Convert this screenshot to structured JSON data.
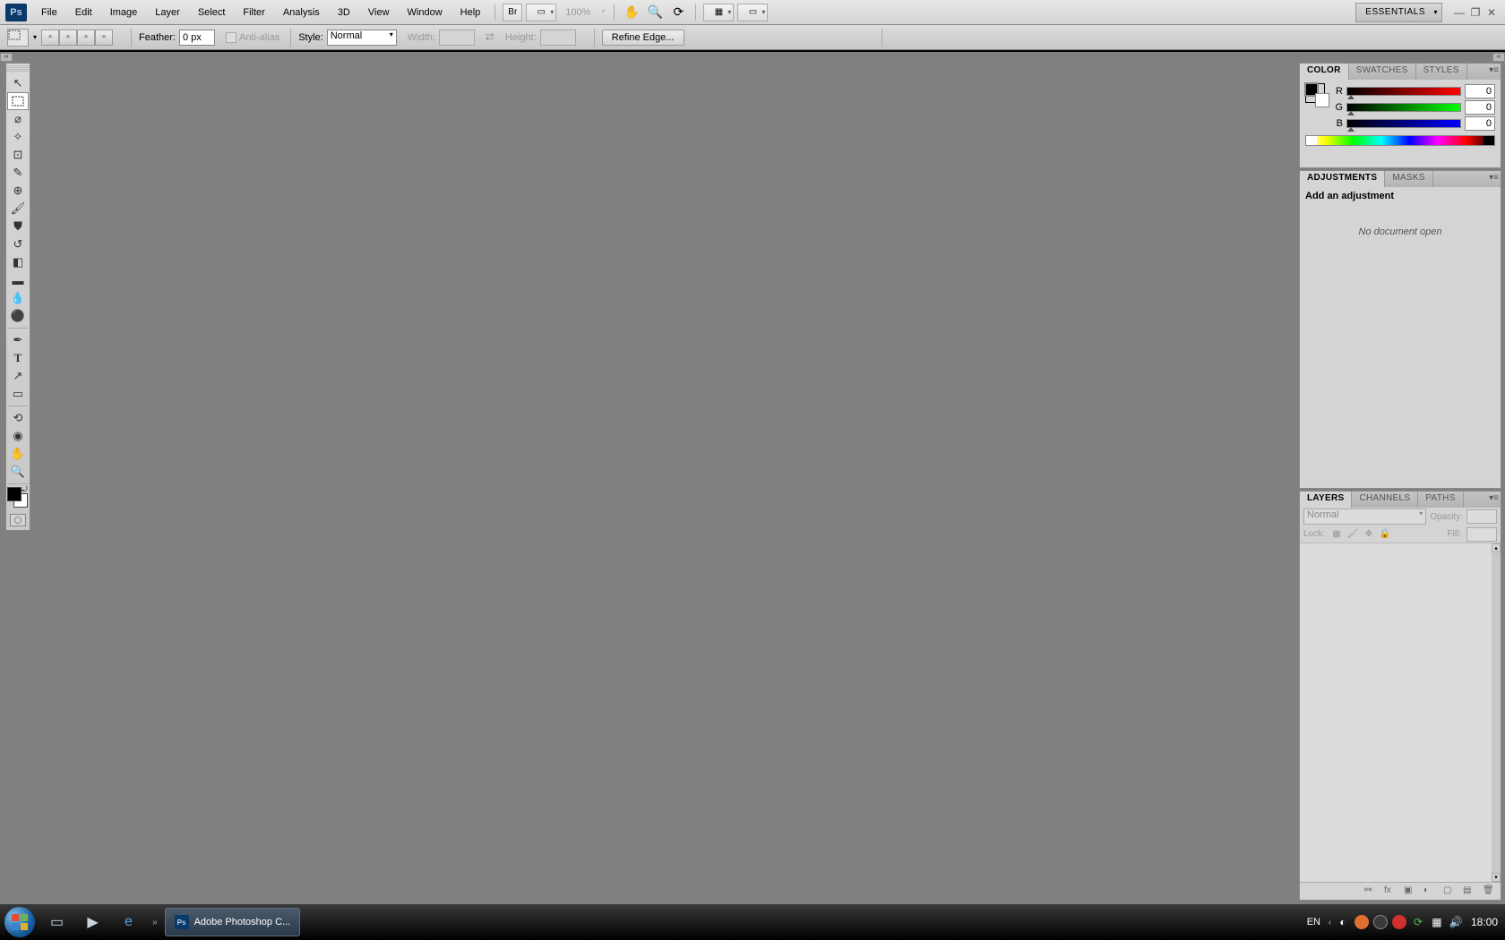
{
  "menubar": {
    "logo": "Ps",
    "items": [
      "File",
      "Edit",
      "Image",
      "Layer",
      "Select",
      "Filter",
      "Analysis",
      "3D",
      "View",
      "Window",
      "Help"
    ],
    "zoom": "100%",
    "workspace": "ESSENTIALS"
  },
  "optbar": {
    "feather_label": "Feather:",
    "feather_value": "0 px",
    "antialias_label": "Anti-alias",
    "style_label": "Style:",
    "style_value": "Normal",
    "width_label": "Width:",
    "height_label": "Height:",
    "refine": "Refine Edge..."
  },
  "tools": [
    "move",
    "marquee",
    "lasso",
    "wand",
    "crop",
    "eyedropper",
    "heal",
    "brush",
    "stamp",
    "history",
    "eraser",
    "gradient",
    "blur",
    "dodge",
    "pen",
    "type",
    "path",
    "shape",
    "3d-rotate",
    "3d-orbit",
    "hand",
    "zoom"
  ],
  "panels": {
    "color": {
      "tabs": [
        "COLOR",
        "SWATCHES",
        "STYLES"
      ],
      "r_label": "R",
      "g_label": "G",
      "b_label": "B",
      "r": "0",
      "g": "0",
      "b": "0"
    },
    "adjustments": {
      "tabs": [
        "ADJUSTMENTS",
        "MASKS"
      ],
      "title": "Add an adjustment",
      "empty": "No document open"
    },
    "layers": {
      "tabs": [
        "LAYERS",
        "CHANNELS",
        "PATHS"
      ],
      "blend": "Normal",
      "opacity_label": "Opacity:",
      "lock_label": "Lock:",
      "fill_label": "Fill:"
    }
  },
  "taskbar": {
    "app": "Adobe Photoshop C...",
    "lang": "EN",
    "time": "18:00"
  }
}
